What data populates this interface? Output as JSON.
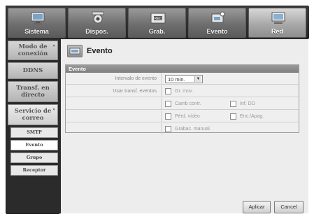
{
  "tabs": [
    {
      "label": "Sistema",
      "icon": "monitor-icon"
    },
    {
      "label": "Dispos.",
      "icon": "camera-icon"
    },
    {
      "label": "Grab.",
      "icon": "rec-icon"
    },
    {
      "label": "Evento",
      "icon": "event-icon"
    },
    {
      "label": "Red",
      "icon": "network-icon"
    }
  ],
  "sidebar": {
    "items": [
      {
        "label": "Modo de conexión",
        "mark": "»"
      },
      {
        "label": "DDNS",
        "mark": ""
      },
      {
        "label": "Transf. en directo",
        "mark": ""
      },
      {
        "label": "Servicio de correo",
        "mark": "»"
      }
    ],
    "sub": [
      "SMTP",
      "Evento",
      "Grupo",
      "Receptor"
    ]
  },
  "main": {
    "title": "Evento",
    "panel_header": "Evento",
    "interval_label": "Intervalo de evento",
    "interval_value": "10 min.",
    "use_label": "Usar transf. eventos",
    "options": {
      "gr_mov": "Gr. mov.",
      "camb_contr": "Camb contr.",
      "inf_dd": "Inf. DD",
      "perd_video": "Pérd. vídeo",
      "enc_apag": "Enc./Apag.",
      "grabac_manual": "Grabac. manual"
    },
    "buttons": {
      "apply": "Aplicar",
      "cancel": "Cancel"
    }
  }
}
